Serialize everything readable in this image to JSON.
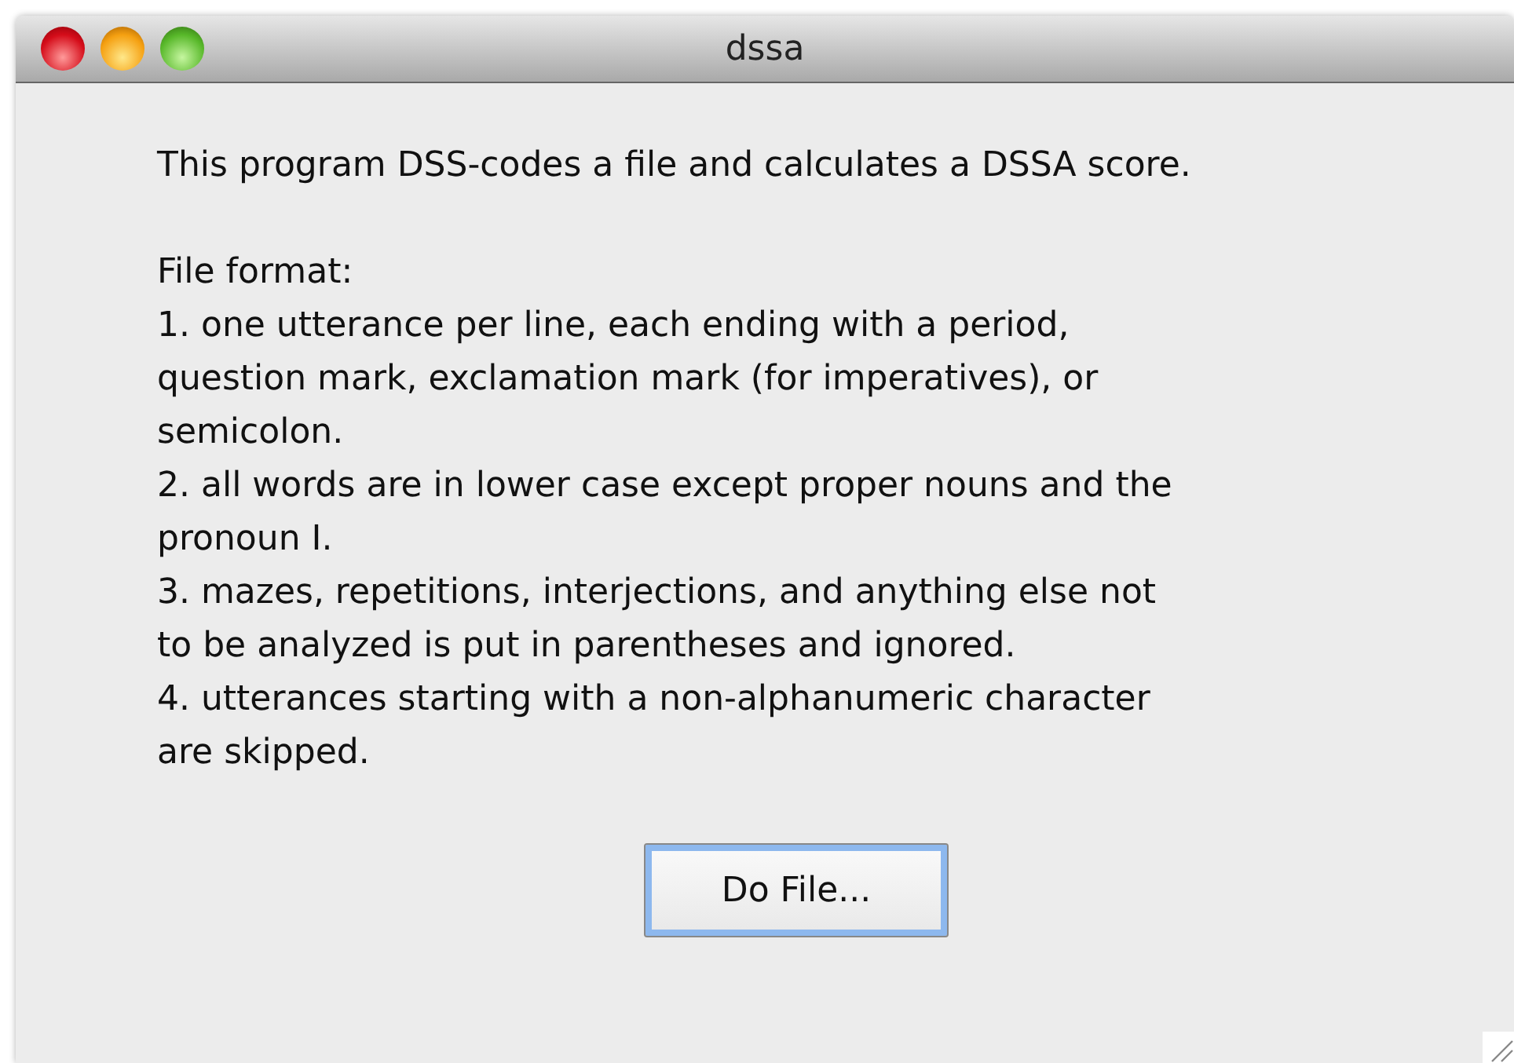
{
  "window": {
    "title": "dssa"
  },
  "intro": "This program DSS-codes a file and calculates a DSSA score.",
  "lines": [
    "File format:",
    "1. one utterance per line, each ending with a period,",
    "question mark, exclamation mark (for imperatives), or",
    "semicolon.",
    "2. all words are in lower case except proper nouns and the",
    "pronoun I.",
    "3. mazes, repetitions, interjections, and anything else not",
    "to be analyzed is put in parentheses and ignored.",
    "4. utterances starting with a non-alphanumeric character",
    "are skipped."
  ],
  "button": {
    "label": "Do File..."
  }
}
